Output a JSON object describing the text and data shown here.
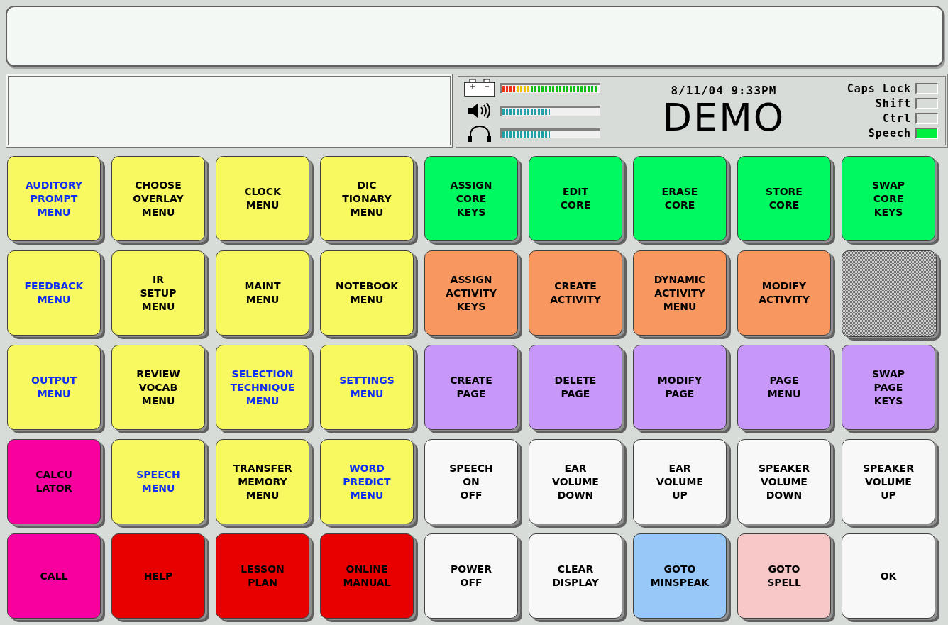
{
  "status": {
    "meters": [
      {
        "kind": "battery",
        "level": 0.97
      },
      {
        "kind": "speaker",
        "level": 0.5
      },
      {
        "kind": "headphones",
        "level": 0.5
      }
    ],
    "datetime": "8/11/04 9:33PM",
    "mode": "DEMO",
    "indicators": [
      {
        "label": "Caps Lock",
        "on": false
      },
      {
        "label": "Shift",
        "on": false
      },
      {
        "label": "Ctrl",
        "on": false
      },
      {
        "label": "Speech",
        "on": true
      }
    ]
  },
  "keys": [
    {
      "kind": "label",
      "label": "AUDITORY\nPROMPT\nMENU",
      "color": "#f8f860",
      "highlighted": true
    },
    {
      "kind": "label",
      "label": "CHOOSE\nOVERLAY\nMENU",
      "color": "#f8f860",
      "highlighted": false
    },
    {
      "kind": "label",
      "label": "CLOCK\nMENU",
      "color": "#f8f860",
      "highlighted": false
    },
    {
      "kind": "label",
      "label": "DIC\nTIONARY\nMENU",
      "color": "#f8f860",
      "highlighted": false
    },
    {
      "kind": "label",
      "label": "ASSIGN\nCORE\nKEYS",
      "color": "#00f860",
      "highlighted": false
    },
    {
      "kind": "label",
      "label": "EDIT\nCORE",
      "color": "#00f860",
      "highlighted": false
    },
    {
      "kind": "label",
      "label": "ERASE\nCORE",
      "color": "#00f860",
      "highlighted": false
    },
    {
      "kind": "label",
      "label": "STORE\nCORE",
      "color": "#00f860",
      "highlighted": false
    },
    {
      "kind": "label",
      "label": "SWAP\nCORE\nKEYS",
      "color": "#00f860",
      "highlighted": false
    },
    {
      "kind": "label",
      "label": "FEEDBACK\nMENU",
      "color": "#f8f860",
      "highlighted": true
    },
    {
      "kind": "label",
      "label": "IR\nSETUP\nMENU",
      "color": "#f8f860",
      "highlighted": false
    },
    {
      "kind": "label",
      "label": "MAINT\nMENU",
      "color": "#f8f860",
      "highlighted": false
    },
    {
      "kind": "label",
      "label": "NOTEBOOK\nMENU",
      "color": "#f8f860",
      "highlighted": false
    },
    {
      "kind": "label",
      "label": "ASSIGN\nACTIVITY\nKEYS",
      "color": "#f89860",
      "highlighted": false
    },
    {
      "kind": "label",
      "label": "CREATE\nACTIVITY",
      "color": "#f89860",
      "highlighted": false
    },
    {
      "kind": "label",
      "label": "DYNAMIC\nACTIVITY\nMENU",
      "color": "#f89860",
      "highlighted": false
    },
    {
      "kind": "label",
      "label": "MODIFY\nACTIVITY",
      "color": "#f89860",
      "highlighted": false
    },
    {
      "kind": "blank"
    },
    {
      "kind": "label",
      "label": "OUTPUT\nMENU",
      "color": "#f8f860",
      "highlighted": true
    },
    {
      "kind": "label",
      "label": "REVIEW\nVOCAB\nMENU",
      "color": "#f8f860",
      "highlighted": false
    },
    {
      "kind": "label",
      "label": "SELECTION\nTECHNIQUE\nMENU",
      "color": "#f8f860",
      "highlighted": true
    },
    {
      "kind": "label",
      "label": "SETTINGS\nMENU",
      "color": "#f8f860",
      "highlighted": true
    },
    {
      "kind": "label",
      "label": "CREATE\nPAGE",
      "color": "#c898f8",
      "highlighted": false
    },
    {
      "kind": "label",
      "label": "DELETE\nPAGE",
      "color": "#c898f8",
      "highlighted": false
    },
    {
      "kind": "label",
      "label": "MODIFY\nPAGE",
      "color": "#c898f8",
      "highlighted": false
    },
    {
      "kind": "label",
      "label": "PAGE\nMENU",
      "color": "#c898f8",
      "highlighted": false
    },
    {
      "kind": "label",
      "label": "SWAP\nPAGE\nKEYS",
      "color": "#c898f8",
      "highlighted": false
    },
    {
      "kind": "label",
      "label": "CALCU\nLATOR",
      "color": "#f800a0",
      "highlighted": false
    },
    {
      "kind": "label",
      "label": "SPEECH\nMENU",
      "color": "#f8f860",
      "highlighted": true
    },
    {
      "kind": "label",
      "label": "TRANSFER\nMEMORY\nMENU",
      "color": "#f8f860",
      "highlighted": false
    },
    {
      "kind": "label",
      "label": "WORD\nPREDICT\nMENU",
      "color": "#f8f860",
      "highlighted": true
    },
    {
      "kind": "label",
      "label": "SPEECH\nON\nOFF",
      "color": "#f8f8f8",
      "highlighted": false
    },
    {
      "kind": "label",
      "label": "EAR\nVOLUME\nDOWN",
      "color": "#f8f8f8",
      "highlighted": false
    },
    {
      "kind": "label",
      "label": "EAR\nVOLUME\nUP",
      "color": "#f8f8f8",
      "highlighted": false
    },
    {
      "kind": "label",
      "label": "SPEAKER\nVOLUME\nDOWN",
      "color": "#f8f8f8",
      "highlighted": false
    },
    {
      "kind": "label",
      "label": "SPEAKER\nVOLUME\nUP",
      "color": "#f8f8f8",
      "highlighted": false
    },
    {
      "kind": "label",
      "label": "CALL",
      "color": "#f800a0",
      "highlighted": false
    },
    {
      "kind": "label",
      "label": "HELP",
      "color": "#e80000",
      "highlighted": false
    },
    {
      "kind": "label",
      "label": "LESSON\nPLAN",
      "color": "#e80000",
      "highlighted": false
    },
    {
      "kind": "label",
      "label": "ONLINE\nMANUAL",
      "color": "#e80000",
      "highlighted": false
    },
    {
      "kind": "label",
      "label": "POWER\nOFF",
      "color": "#f8f8f8",
      "highlighted": false
    },
    {
      "kind": "label",
      "label": "CLEAR\nDISPLAY",
      "color": "#f8f8f8",
      "highlighted": false
    },
    {
      "kind": "label",
      "label": "GOTO\nMINSPEAK",
      "color": "#98c8f8",
      "highlighted": false
    },
    {
      "kind": "label",
      "label": "GOTO\nSPELL",
      "color": "#f8c8c8",
      "highlighted": false
    },
    {
      "kind": "label",
      "label": "OK",
      "color": "#f8f8f8",
      "highlighted": false
    }
  ]
}
